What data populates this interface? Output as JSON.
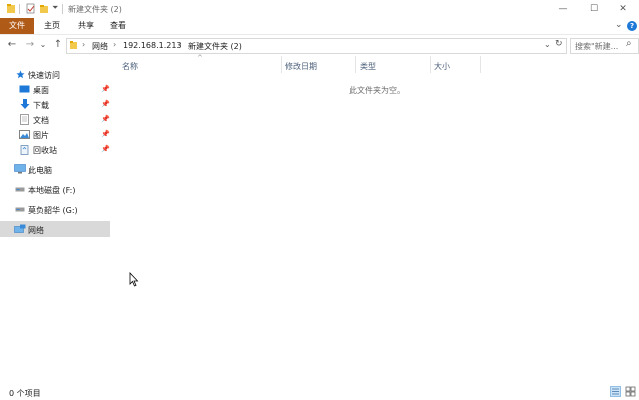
{
  "window": {
    "title": "新建文件夹 (2)",
    "minimize": "—",
    "maximize": "☐",
    "close": "✕"
  },
  "ribbon": {
    "tabs": [
      "文件",
      "主页",
      "共享",
      "查看"
    ],
    "collapse": "⌄",
    "help": "?"
  },
  "nav": {
    "back": "←",
    "forward": "→",
    "recent": "⌄",
    "up": "↑",
    "breadcrumb": [
      "网络",
      "192.168.1.213",
      "新建文件夹 (2)"
    ],
    "dropdown": "⌄",
    "refresh": "↻",
    "search_placeholder": "搜索\"新建...",
    "search_icon": "⌕"
  },
  "sidebar": {
    "quick_access": "快速访问",
    "items": [
      {
        "label": "桌面",
        "icon": "desktop-icon",
        "pinned": true
      },
      {
        "label": "下载",
        "icon": "download-icon",
        "pinned": true
      },
      {
        "label": "文档",
        "icon": "document-icon",
        "pinned": true
      },
      {
        "label": "图片",
        "icon": "picture-icon",
        "pinned": true
      },
      {
        "label": "回收站",
        "icon": "recycle-bin-icon",
        "pinned": true
      }
    ],
    "this_pc": "此电脑",
    "drive_local": "本地磁盘 (F:)",
    "drive_g": "莫负韶华 (G:)",
    "network": "网络"
  },
  "columns": {
    "name": "名称",
    "modified": "修改日期",
    "type": "类型",
    "size": "大小",
    "sort_indicator": "^"
  },
  "content": {
    "empty_message": "此文件夹为空。"
  },
  "status": {
    "items": "0 个项目"
  },
  "colors": {
    "file_tab": "#b05a17",
    "selected": "#d9d9d9",
    "accent": "#1e78d7"
  }
}
